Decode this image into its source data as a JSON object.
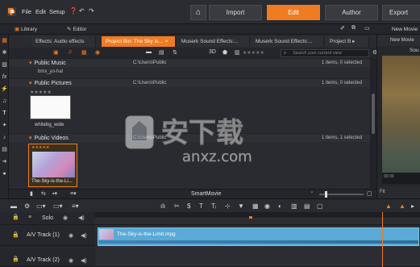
{
  "menu": {
    "file": "File",
    "edit": "Edit",
    "setup": "Setup"
  },
  "nav": {
    "import": "Import",
    "edit": "Edit",
    "author": "Author",
    "export": "Export"
  },
  "subtabs": {
    "library": "Library",
    "editor": "Editor",
    "new_movie": "New Movie"
  },
  "bin_tabs": [
    "Effects: Audio effects",
    "Project Bin: The Sky is...",
    "Muserk Sound Effects:...",
    "Muserk Sound Effects:...",
    "Project B"
  ],
  "search": {
    "placeholder": "Search your current view"
  },
  "folders": [
    {
      "name": "Public Music",
      "path": "C:\\Users\\Public",
      "count": "1 items, 0 selected",
      "item": "bmx_yo-ha!"
    },
    {
      "name": "Public Pictures",
      "path": "C:\\Users\\Public",
      "count": "1 items, 0 selected",
      "item": "whitebg_wide"
    },
    {
      "name": "Public Videos",
      "path": "C:\\Users\\Public",
      "count": "1 items, 1 selected",
      "item": "The-Sky-is-the-Li..."
    }
  ],
  "footer": {
    "smartmovie": "SmartMovie"
  },
  "player": {
    "sub": "Sou",
    "fit": "Fit",
    "ruler": "00:00"
  },
  "timeline": {
    "solo": "Solo",
    "track1": "A/V Track (1)",
    "track2": "A/V Track (2)",
    "clip_name": "The-Sky-is-the-Limit.mpg"
  },
  "watermark": {
    "cn": "安下载",
    "en": "anxz.com"
  },
  "colors": {
    "accent": "#f07c22",
    "clip": "#5aa9d6"
  }
}
